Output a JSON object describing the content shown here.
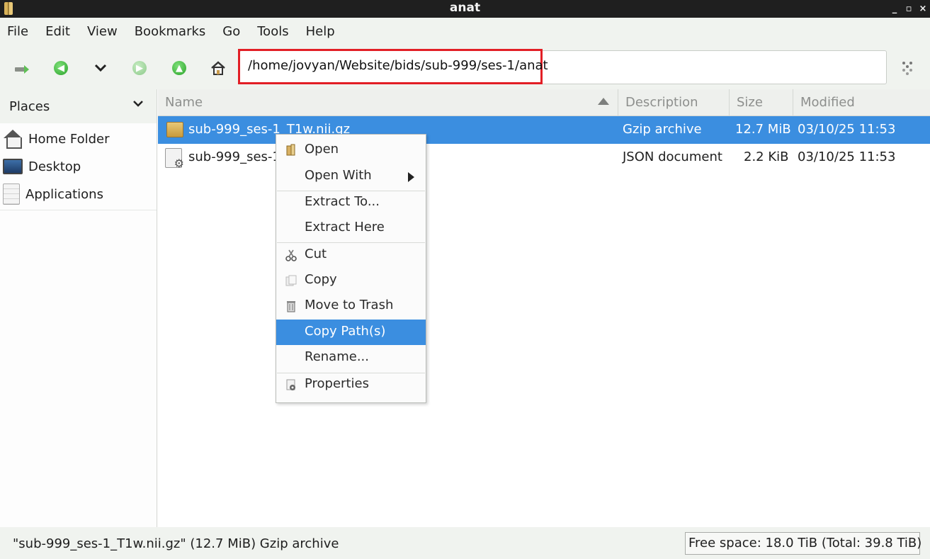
{
  "window": {
    "title": "anat",
    "minimize": "_",
    "maximize": "▫",
    "close": "×"
  },
  "menubar": [
    "File",
    "Edit",
    "View",
    "Bookmarks",
    "Go",
    "Tools",
    "Help"
  ],
  "toolbar": {
    "path": "/home/jovyan/Website/bids/sub-999/ses-1/anat",
    "icons": [
      "new-tab-icon",
      "back-icon",
      "history-icon",
      "forward-icon",
      "up-icon",
      "home-icon",
      "bookmark-icon"
    ]
  },
  "sidebar": {
    "header": "Places",
    "items": [
      {
        "label": "Home Folder",
        "icon": "home-icon"
      },
      {
        "label": "Desktop",
        "icon": "desktop-icon"
      },
      {
        "label": "Applications",
        "icon": "applications-icon"
      }
    ]
  },
  "columns": {
    "name": "Name",
    "description": "Description",
    "size": "Size",
    "modified": "Modified"
  },
  "files": [
    {
      "name": "sub-999_ses-1_T1w.nii.gz",
      "description": "Gzip archive",
      "size": "12.7 MiB",
      "modified": "03/10/25 11:53",
      "selected": true
    },
    {
      "name": "sub-999_ses-1",
      "description": "JSON document",
      "size": "2.2 KiB",
      "modified": "03/10/25 11:53",
      "selected": false
    }
  ],
  "context_menu": {
    "items": [
      "Open",
      "Open With",
      "Extract To...",
      "Extract Here",
      "Cut",
      "Copy",
      "Move to Trash",
      "Copy Path(s)",
      "Rename...",
      "Properties"
    ],
    "active": "Copy Path(s)"
  },
  "status": {
    "selection": "\"sub-999_ses-1_T1w.nii.gz\" (12.7 MiB) Gzip archive",
    "free_space": "Free space: 18.0 TiB (Total: 39.8 TiB)"
  },
  "colors": {
    "selection": "#3b8ee0",
    "highlight_box": "#e21f26",
    "accent_green": "#2aa32a"
  }
}
